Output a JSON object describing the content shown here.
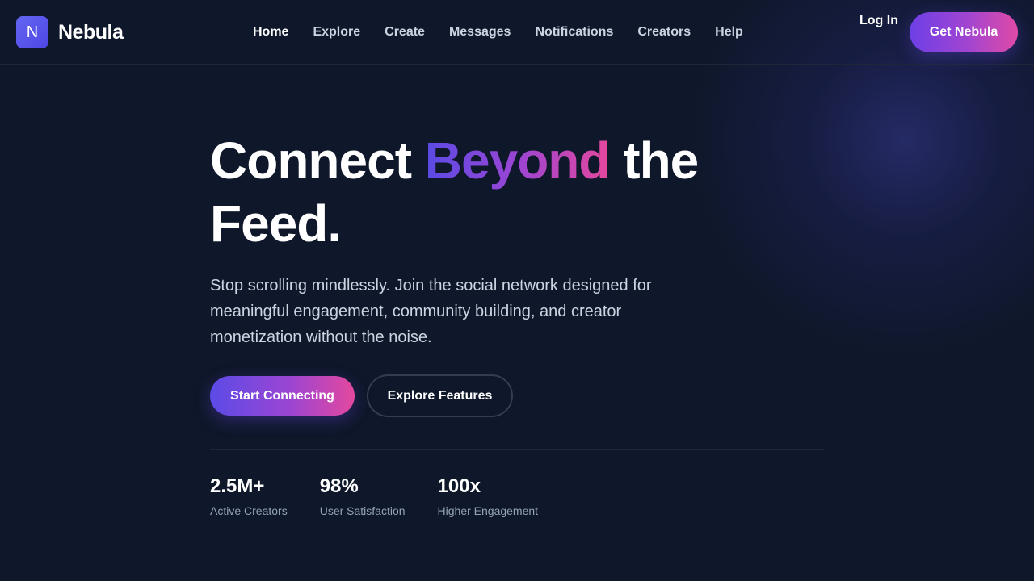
{
  "brand": {
    "logo_letter": "N",
    "name": "Nebula"
  },
  "nav": {
    "items": [
      {
        "label": "Home",
        "active": true
      },
      {
        "label": "Explore",
        "active": false
      },
      {
        "label": "Create",
        "active": false
      },
      {
        "label": "Messages",
        "active": false
      },
      {
        "label": "Notifications",
        "active": false
      },
      {
        "label": "Creators",
        "active": false
      },
      {
        "label": "Help",
        "active": false
      }
    ],
    "login_label": "Log In",
    "cta_label": "Get Nebula"
  },
  "hero": {
    "title_part1": "Connect ",
    "title_highlight": "Beyond",
    "title_part2": " the Feed.",
    "subtitle": "Stop scrolling mindlessly. Join the social network designed for meaningful engagement, community building, and creator monetization without the noise.",
    "primary_button": "Start Connecting",
    "secondary_button": "Explore Features"
  },
  "stats": [
    {
      "value": "2.5M+",
      "label": "Active Creators"
    },
    {
      "value": "98%",
      "label": "User Satisfaction"
    },
    {
      "value": "100x",
      "label": "Higher Engagement"
    }
  ],
  "colors": {
    "background": "#0f172a",
    "accent_start": "#5b4be6",
    "accent_mid": "#9b45d3",
    "accent_end": "#e4489e",
    "muted_text": "#94a3b8"
  }
}
